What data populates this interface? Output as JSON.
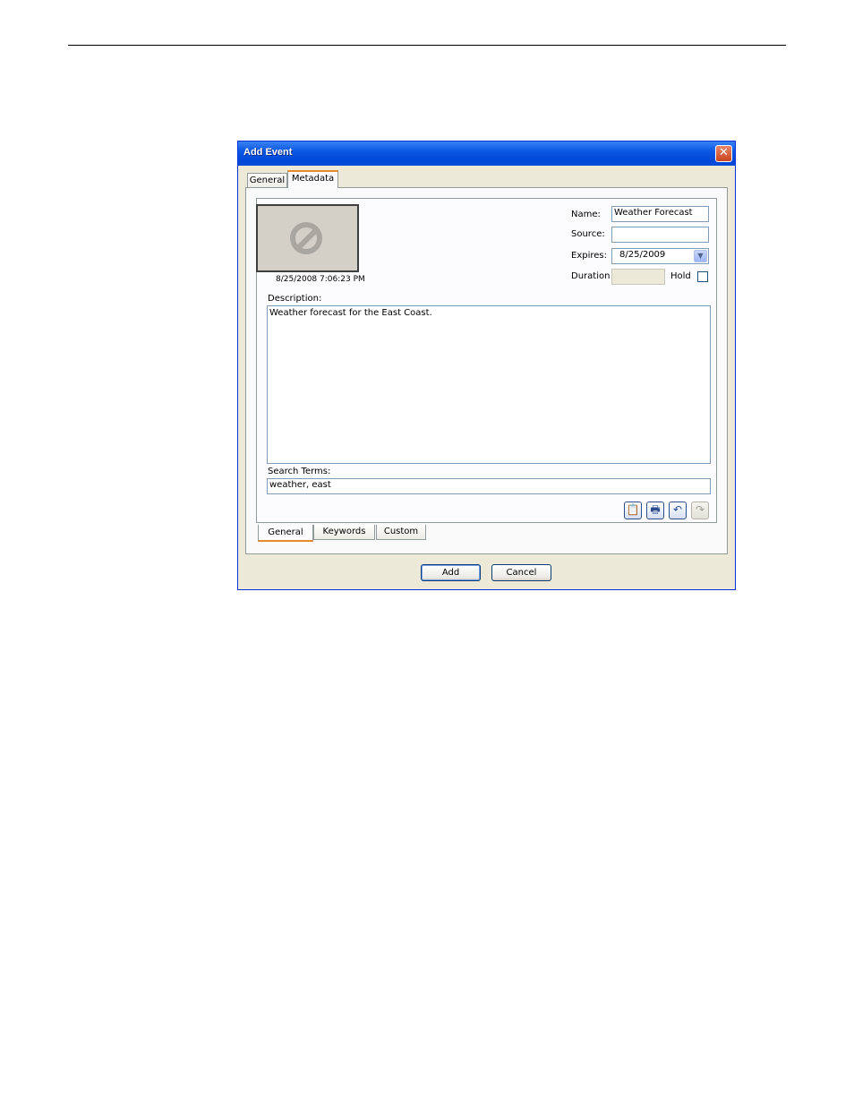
{
  "dialog": {
    "title": "Add Event",
    "close_glyph": "✕",
    "top_tabs": [
      {
        "label": "General",
        "selected": false
      },
      {
        "label": "Metadata",
        "selected": true
      }
    ],
    "thumbnail": {
      "icon": "no-symbol-icon",
      "timestamp": "8/25/2008 7:06:23 PM"
    },
    "name": {
      "label": "Name:",
      "value": "Weather Forecast"
    },
    "source": {
      "label": "Source:",
      "value": ""
    },
    "expires": {
      "label": "Expires:",
      "value": "8/25/2009",
      "arrow": "▼"
    },
    "duration": {
      "label": "Duration",
      "value": ""
    },
    "hold": {
      "label": "Hold",
      "checked": false
    },
    "description": {
      "label": "Description:",
      "value": "Weather forecast for the East Coast."
    },
    "search_terms": {
      "label": "Search Terms:",
      "value": "weather, east"
    },
    "toolbar": [
      {
        "icon": "paste-icon",
        "glyph": "📋",
        "enabled": true
      },
      {
        "icon": "print-icon",
        "glyph": "🖶",
        "enabled": true
      },
      {
        "icon": "undo-icon",
        "glyph": "↶",
        "enabled": true
      },
      {
        "icon": "redo-icon",
        "glyph": "↷",
        "enabled": false
      }
    ],
    "bottom_tabs": [
      {
        "label": "General",
        "selected": true
      },
      {
        "label": "Keywords",
        "selected": false
      },
      {
        "label": "Custom",
        "selected": false
      }
    ],
    "buttons": {
      "add": "Add",
      "cancel": "Cancel"
    },
    "colors": {
      "titlebar": "#0a58e4",
      "tab_highlight": "#e68b2c",
      "dialog_bg": "#ece9d8"
    }
  }
}
